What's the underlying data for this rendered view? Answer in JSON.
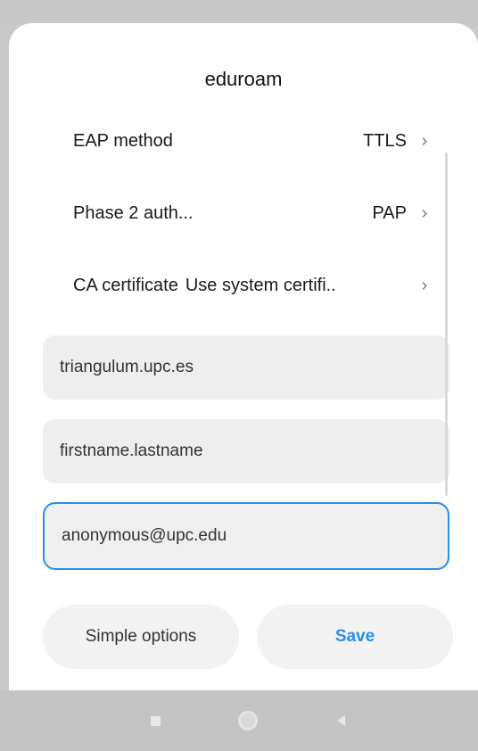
{
  "dialog": {
    "title": "eduroam"
  },
  "settings": [
    {
      "label": "EAP method",
      "value": "TTLS",
      "chevron": "›"
    },
    {
      "label": "Phase 2 auth...",
      "value": "PAP",
      "chevron": "›"
    },
    {
      "label": "CA certificate",
      "value": "Use system certifi..",
      "chevron": "›"
    }
  ],
  "fields": {
    "identity": "triangulum.upc.es",
    "username": "firstname.lastname",
    "anonymous_identity": "anonymous@upc.edu"
  },
  "buttons": {
    "simple_options": "Simple options",
    "save": "Save"
  },
  "colors": {
    "accent": "#2b8fe8",
    "field_bg": "#eeeeee",
    "navbar_bg": "#c4c4c4"
  },
  "navbar": {
    "icons": [
      "recents-square-icon",
      "home-circle-icon",
      "back-triangle-icon"
    ]
  }
}
